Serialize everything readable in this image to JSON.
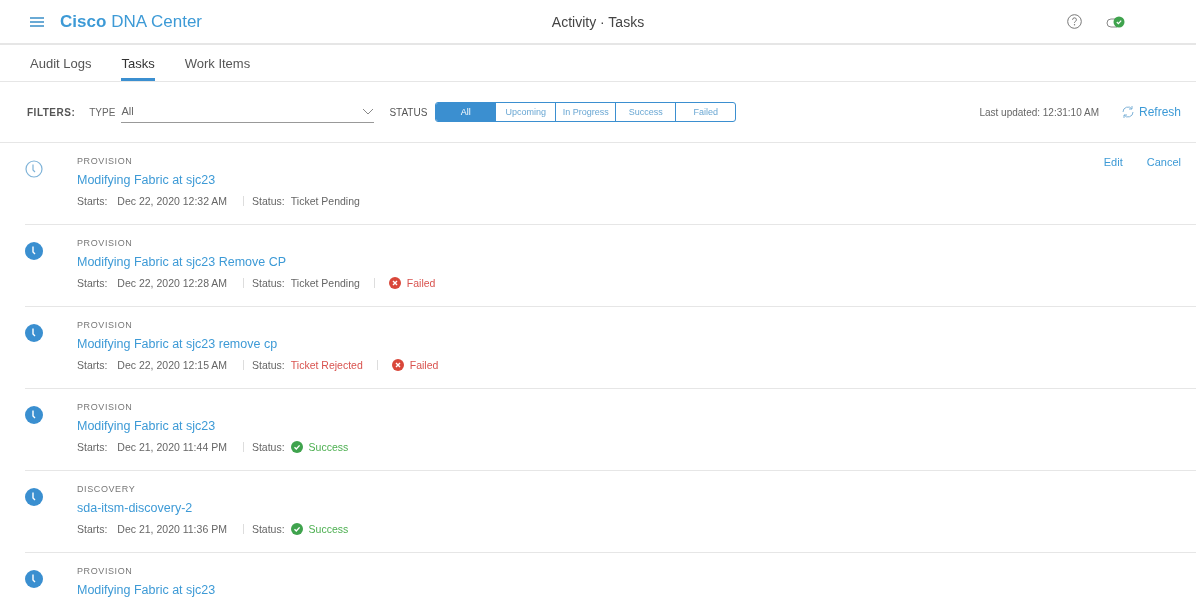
{
  "header": {
    "brand_bold": "Cisco",
    "brand_rest": "DNA Center",
    "title": "Activity · Tasks"
  },
  "tabs": [
    {
      "label": "Audit Logs",
      "selected": false
    },
    {
      "label": "Tasks",
      "selected": true
    },
    {
      "label": "Work Items",
      "selected": false
    }
  ],
  "filters": {
    "label": "FILTERS:",
    "type_label": "TYPE",
    "type_value": "All",
    "status_label": "STATUS",
    "status_options": [
      {
        "label": "All",
        "selected": true
      },
      {
        "label": "Upcoming",
        "selected": false
      },
      {
        "label": "In Progress",
        "selected": false
      },
      {
        "label": "Success",
        "selected": false
      },
      {
        "label": "Failed",
        "selected": false
      }
    ],
    "last_updated": "Last updated: 12:31:10 AM",
    "refresh": "Refresh"
  },
  "tasks": [
    {
      "kind": "upcoming",
      "category": "PROVISION",
      "title": "Modifying Fabric at sjc23",
      "starts_label": "Starts:",
      "starts": "Dec 22, 2020 12:32 AM",
      "status_label": "Status:",
      "ticket": {
        "text": "Ticket Pending",
        "kind": "pending"
      },
      "actions": [
        "Edit",
        "Cancel"
      ]
    },
    {
      "kind": "scheduled",
      "category": "PROVISION",
      "title": "Modifying Fabric at sjc23 Remove CP",
      "starts_label": "Starts:",
      "starts": "Dec 22, 2020 12:28 AM",
      "status_label": "Status:",
      "ticket": {
        "text": "Ticket Pending",
        "kind": "pending"
      },
      "result": {
        "text": "Failed",
        "kind": "failed"
      }
    },
    {
      "kind": "scheduled",
      "category": "PROVISION",
      "title": "Modifying Fabric at sjc23 remove cp",
      "starts_label": "Starts:",
      "starts": "Dec 22, 2020 12:15 AM",
      "status_label": "Status:",
      "ticket": {
        "text": "Ticket Rejected",
        "kind": "rejected"
      },
      "result": {
        "text": "Failed",
        "kind": "failed"
      }
    },
    {
      "kind": "scheduled",
      "category": "PROVISION",
      "title": "Modifying Fabric at sjc23",
      "starts_label": "Starts:",
      "starts": "Dec 21, 2020 11:44 PM",
      "status_label": "Status:",
      "result": {
        "text": "Success",
        "kind": "success"
      }
    },
    {
      "kind": "scheduled",
      "category": "DISCOVERY",
      "title": "sda-itsm-discovery-2",
      "starts_label": "Starts:",
      "starts": "Dec 21, 2020 11:36 PM",
      "status_label": "Status:",
      "result": {
        "text": "Success",
        "kind": "success"
      }
    },
    {
      "kind": "scheduled",
      "category": "PROVISION",
      "title": "Modifying Fabric at sjc23"
    }
  ]
}
